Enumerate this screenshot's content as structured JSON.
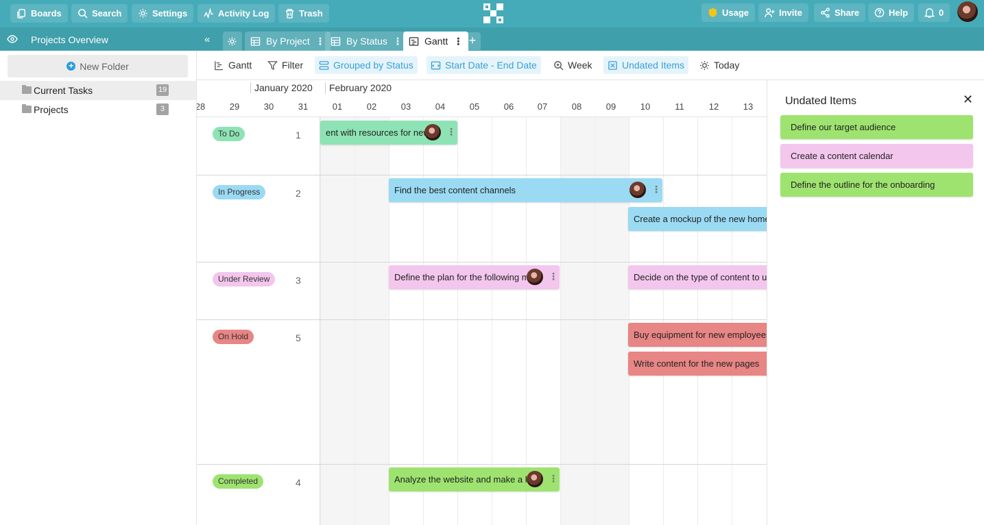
{
  "topbar": {
    "buttons": [
      {
        "label": "Boards",
        "icon": "boards-icon"
      },
      {
        "label": "Search",
        "icon": "search-icon"
      },
      {
        "label": "Settings",
        "icon": "gear-icon"
      },
      {
        "label": "Activity Log",
        "icon": "activity-icon"
      },
      {
        "label": "Trash",
        "icon": "trash-icon"
      }
    ],
    "right_buttons": [
      {
        "label": "Usage",
        "icon": "shield-icon"
      },
      {
        "label": "Invite",
        "icon": "add-user-icon"
      },
      {
        "label": "Share",
        "icon": "share-icon"
      },
      {
        "label": "Help",
        "icon": "help-icon"
      }
    ],
    "notifications_count": "0"
  },
  "subbar": {
    "title": "Projects Overview",
    "tabs": [
      {
        "label": "By Project"
      },
      {
        "label": "By Status"
      },
      {
        "label": "Gantt"
      }
    ],
    "add_tab_label": "+"
  },
  "sidebar": {
    "new_folder_label": "New Folder",
    "folders": [
      {
        "label": "Current Tasks",
        "count": "19"
      },
      {
        "label": "Projects",
        "count": "3"
      }
    ]
  },
  "toolbar": {
    "items": [
      {
        "label": "Gantt"
      },
      {
        "label": "Filter"
      },
      {
        "label": "Grouped by Status"
      },
      {
        "label": "Start Date - End Date"
      },
      {
        "label": "Week"
      },
      {
        "label": "Undated Items"
      },
      {
        "label": "Today"
      }
    ]
  },
  "timeline": {
    "months": [
      "January 2020",
      "February 2020"
    ],
    "days": [
      "28",
      "29",
      "30",
      "31",
      "01",
      "02",
      "03",
      "04",
      "05",
      "06",
      "07",
      "08",
      "09",
      "10",
      "11",
      "12",
      "13"
    ],
    "groups": [
      {
        "status": "To Do",
        "count": "1",
        "color": "#8ee3b5"
      },
      {
        "status": "In Progress",
        "count": "2",
        "color": "#9bdaf3"
      },
      {
        "status": "Under Review",
        "count": "3",
        "color": "#f3c6ee"
      },
      {
        "status": "On Hold",
        "count": "5",
        "color": "#e88585"
      },
      {
        "status": "Completed",
        "count": "4",
        "color": "#9ee36f"
      }
    ],
    "tasks": [
      {
        "label": "ent with resources for new"
      },
      {
        "label": "Find the best content channels"
      },
      {
        "label": "Create a mockup of the new home"
      },
      {
        "label": "Define the plan for the following m"
      },
      {
        "label": "Decide on the type of content to us"
      },
      {
        "label": "Buy equipment for new employees"
      },
      {
        "label": "Write content for the new pages"
      },
      {
        "label": "Analyze the website and make a lis"
      }
    ]
  },
  "undated": {
    "title": "Undated Items",
    "items": [
      {
        "label": "Define our target audience",
        "color": "#9ee36f"
      },
      {
        "label": "Create a content calendar",
        "color": "#f3c6ee"
      },
      {
        "label": "Define the outline for the onboarding",
        "color": "#9ee36f"
      }
    ]
  }
}
